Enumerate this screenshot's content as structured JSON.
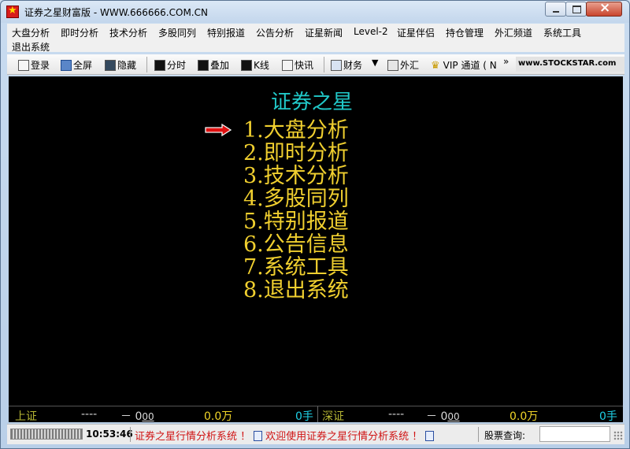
{
  "window": {
    "title": "证券之星财富版 - WWW.666666.COM.CN"
  },
  "menu": {
    "items": [
      "大盘分析",
      "即时分析",
      "技术分析",
      "多股同列",
      "特别报道",
      "公告分析",
      "证星新闻",
      "Level-2",
      "证星伴侣",
      "持仓管理",
      "外汇频道",
      "系统工具",
      "退出系统"
    ]
  },
  "toolbar": {
    "items": [
      {
        "label": "登录",
        "icon": "login-icon"
      },
      {
        "label": "全屏",
        "icon": "fullscreen-icon"
      },
      {
        "label": "隐藏",
        "icon": "hide-icon"
      },
      {
        "label": "分时",
        "icon": "timeshare-chart-icon"
      },
      {
        "label": "叠加",
        "icon": "overlay-chart-icon"
      },
      {
        "label": "K线",
        "icon": "kline-icon"
      },
      {
        "label": "快讯",
        "icon": "news-flash-icon"
      },
      {
        "label": "财务",
        "icon": "finance-icon"
      },
      {
        "label": "外汇",
        "icon": "forex-icon"
      },
      {
        "label": "VIP 通道 ( N",
        "icon": "vip-crown-icon"
      }
    ],
    "overflow": "»",
    "logo_text": "www.STOCKSTAR.com"
  },
  "main": {
    "title": "证券之星",
    "entries": [
      "1.大盘分析",
      "2.即时分析",
      "3.技术分析",
      "4.多股同列",
      "5.特别报道",
      "6.公告信息",
      "7.系统工具",
      "8.退出系统"
    ],
    "selected_index": 0
  },
  "quotes": [
    {
      "name": "上证",
      "price": "----",
      "change": "－ 0",
      "change_frac": "00",
      "volume": "0.0",
      "volume_unit": "万",
      "hands": "0",
      "hands_unit": "手"
    },
    {
      "name": "深证",
      "price": "----",
      "change": "－ 0",
      "change_frac": "00",
      "volume": "0.0",
      "volume_unit": "万",
      "hands": "0",
      "hands_unit": "手"
    }
  ],
  "status": {
    "time": "10:53:46",
    "ticker_1": "证券之星行情分析系统 ！",
    "ticker_2": "欢迎使用证券之星行情分析系统 ！",
    "query_label": "股票查询:",
    "query_value": ""
  },
  "colors": {
    "title_cyan": "#21c9c9",
    "menu_yellow": "#f0cf2f",
    "arrow_red": "#e01010",
    "quote_name": "#b7b734",
    "quote_yellow": "#f2d628",
    "quote_cyan": "#1ed0e6"
  }
}
